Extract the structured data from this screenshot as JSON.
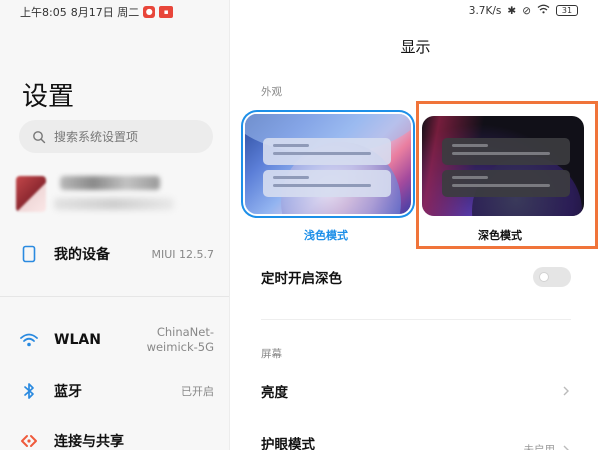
{
  "status_bar": {
    "time": "上午8:05",
    "date": "8月17日 周二",
    "network_speed": "3.7K/s",
    "battery": "31"
  },
  "sidebar": {
    "title": "设置",
    "search_placeholder": "搜索系统设置项",
    "items": [
      {
        "label": "我的设备",
        "value": "MIUI 12.5.7",
        "icon": "phone-icon"
      },
      {
        "label": "WLAN",
        "value": "ChinaNet-weimick-5G",
        "icon": "wifi-icon"
      },
      {
        "label": "蓝牙",
        "value": "已开启",
        "icon": "bluetooth-icon"
      },
      {
        "label": "连接与共享",
        "value": "",
        "icon": "share-icon"
      }
    ]
  },
  "display": {
    "title": "显示",
    "appearance_section": "外观",
    "light_mode_label": "浅色模式",
    "dark_mode_label": "深色模式",
    "scheduled_dark_label": "定时开启深色",
    "screen_section": "屏幕",
    "brightness_label": "亮度",
    "eye_care_label": "护眼模式",
    "eye_care_value": "未启用"
  },
  "colors": {
    "accent": "#1d8fe8",
    "highlight": "#f0743a"
  }
}
